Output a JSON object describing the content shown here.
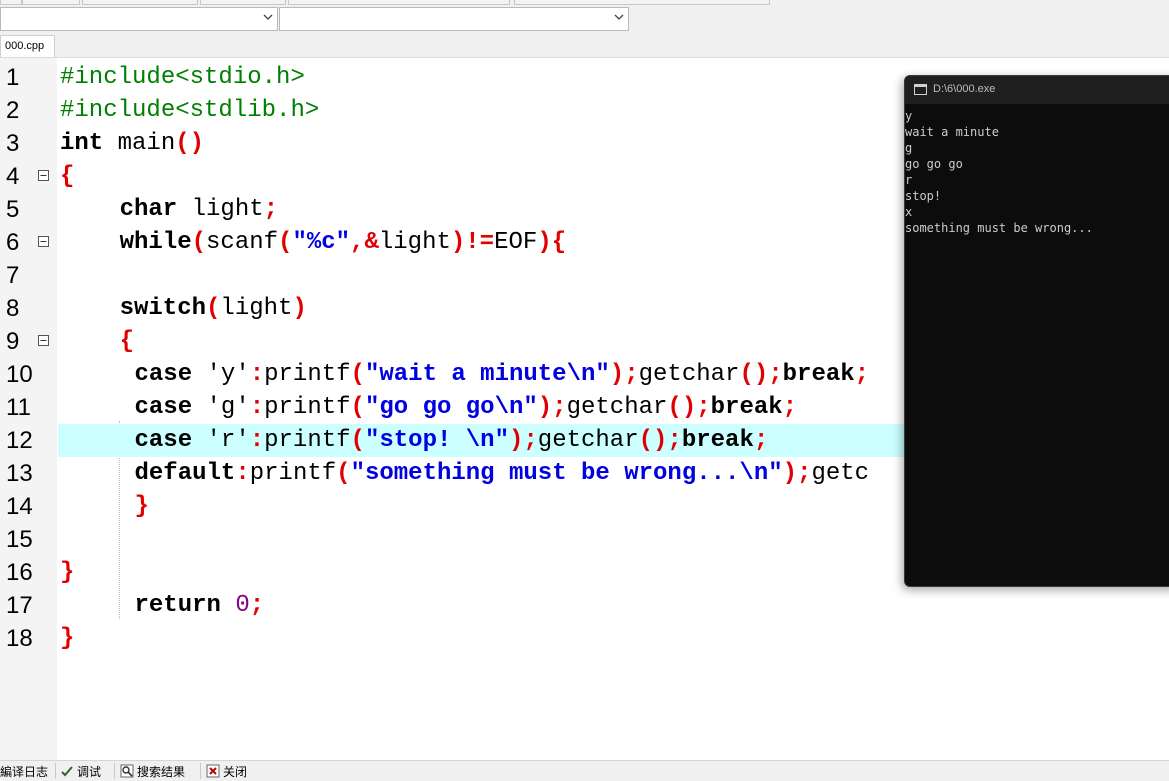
{
  "file_tab": {
    "label": "000.cpp"
  },
  "code_lines": [
    {
      "no": "1",
      "fold": false
    },
    {
      "no": "2",
      "fold": false
    },
    {
      "no": "3",
      "fold": false
    },
    {
      "no": "4",
      "fold": true
    },
    {
      "no": "5",
      "fold": false
    },
    {
      "no": "6",
      "fold": true
    },
    {
      "no": "7",
      "fold": false
    },
    {
      "no": "8",
      "fold": false
    },
    {
      "no": "9",
      "fold": true
    },
    {
      "no": "10",
      "fold": false
    },
    {
      "no": "11",
      "fold": false
    },
    {
      "no": "12",
      "fold": false
    },
    {
      "no": "13",
      "fold": false
    },
    {
      "no": "14",
      "fold": false
    },
    {
      "no": "15",
      "fold": false
    },
    {
      "no": "16",
      "fold": false
    },
    {
      "no": "17",
      "fold": false
    },
    {
      "no": "18",
      "fold": false
    }
  ],
  "code": {
    "l1_inc": "#include<stdio.h>",
    "l2_inc": "#include<stdlib.h>",
    "l3_int": "int",
    "l3_main": " main",
    "l3_par": "()",
    "l4_brace": "{",
    "l5_char": "char",
    "l5_light": " light",
    "l5_semi": ";",
    "l6_while": "while",
    "l6_p1": "(",
    "l6_scanf": "scanf",
    "l6_p2": "(",
    "l6_fmt": "\"%c\"",
    "l6_comma": ",&",
    "l6_light": "light",
    "l6_ne": ")!=",
    "l6_eof": "EOF",
    "l6_end": "){",
    "l8_switch": "switch",
    "l8_p1": "(",
    "l8_light": "light",
    "l8_p2": ")",
    "l9_brace": "{",
    "l10_case": "case",
    "l10_chr": " 'y'",
    "l10_colon": ":",
    "l10_printf": "printf",
    "l10_p1": "(",
    "l10_str": "\"wait a minute\\n\"",
    "l10_p2": ");",
    "l10_getchar": "getchar",
    "l10_p3": "();",
    "l10_break": "break",
    "l10_semi": ";",
    "l11_case": "case",
    "l11_chr": " 'g'",
    "l11_colon": ":",
    "l11_printf": "printf",
    "l11_p1": "(",
    "l11_str": "\"go go go\\n\"",
    "l11_p2": ");",
    "l11_getchar": "getchar",
    "l11_p3": "();",
    "l11_break": "break",
    "l11_semi": ";",
    "l12_case": "case",
    "l12_chr": " 'r'",
    "l12_colon": ":",
    "l12_printf": "printf",
    "l12_p1": "(",
    "l12_str": "\"stop! \\n\"",
    "l12_p2": ");",
    "l12_getchar": "getchar",
    "l12_p3": "();",
    "l12_break": "break",
    "l12_semi": ";",
    "l13_default": "default",
    "l13_colon": ":",
    "l13_printf": "printf",
    "l13_p1": "(",
    "l13_str": "\"something must be wrong...\\n\"",
    "l13_p2": ");",
    "l13_getc": "getc",
    "l14_brace": "}",
    "l16_brace": "}",
    "l17_return": "return",
    "l17_zero": "0",
    "l17_semi": ";",
    "l18_brace": "}"
  },
  "console": {
    "title": "D:\\6\\000.exe",
    "lines": [
      "y",
      "wait a minute",
      "g",
      "go go go",
      "r",
      "stop!",
      "x",
      "something must be wrong..."
    ]
  },
  "bottom_tabs": {
    "compile_log": "編译日志",
    "debug": "调试",
    "search_results": "搜索结果",
    "close": "关闭"
  },
  "colors": {
    "keyword": "#000000",
    "preprocessor": "#008000",
    "string": "#0000e0",
    "symbol": "#e00000",
    "number": "#880088",
    "current_line": "#ccffff",
    "console_bg": "#0c0c0c"
  },
  "highlighted_line": "12"
}
